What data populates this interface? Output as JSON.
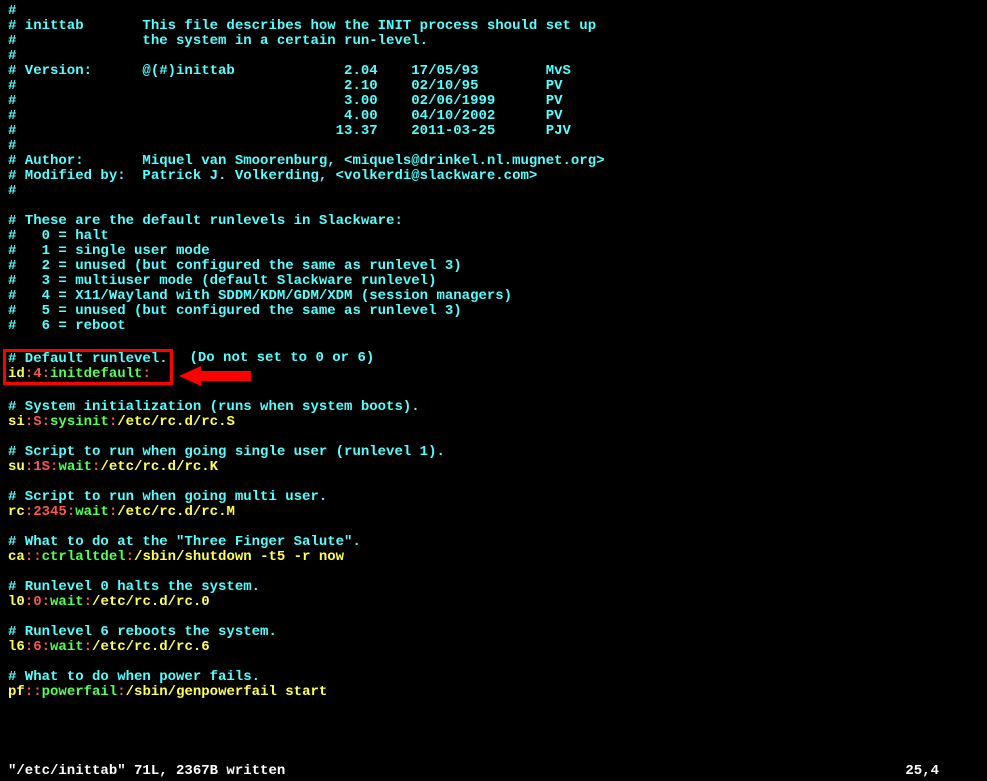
{
  "lines": [
    {
      "segments": [
        {
          "cls": "c",
          "t": "#"
        }
      ]
    },
    {
      "segments": [
        {
          "cls": "c",
          "t": "# inittab       This file describes how the INIT process should set up"
        }
      ]
    },
    {
      "segments": [
        {
          "cls": "c",
          "t": "#               the system in a certain run-level."
        }
      ]
    },
    {
      "segments": [
        {
          "cls": "c",
          "t": "#"
        }
      ]
    },
    {
      "segments": [
        {
          "cls": "c",
          "t": "# Version:      @(#)inittab             2.04    17/05/93        MvS"
        }
      ]
    },
    {
      "segments": [
        {
          "cls": "c",
          "t": "#                                       2.10    02/10/95        PV"
        }
      ]
    },
    {
      "segments": [
        {
          "cls": "c",
          "t": "#                                       3.00    02/06/1999      PV"
        }
      ]
    },
    {
      "segments": [
        {
          "cls": "c",
          "t": "#                                       4.00    04/10/2002      PV"
        }
      ]
    },
    {
      "segments": [
        {
          "cls": "c",
          "t": "#                                      13.37    2011-03-25      PJV"
        }
      ]
    },
    {
      "segments": [
        {
          "cls": "c",
          "t": "#"
        }
      ]
    },
    {
      "segments": [
        {
          "cls": "c",
          "t": "# Author:       Miquel van Smoorenburg, <miquels@drinkel.nl.mugnet.org>"
        }
      ]
    },
    {
      "segments": [
        {
          "cls": "c",
          "t": "# Modified by:  Patrick J. Volkerding, <volkerdi@slackware.com>"
        }
      ]
    },
    {
      "segments": [
        {
          "cls": "c",
          "t": "#"
        }
      ]
    },
    {
      "segments": [
        {
          "cls": "c",
          "t": ""
        }
      ]
    },
    {
      "segments": [
        {
          "cls": "c",
          "t": "# These are the default runlevels in Slackware:"
        }
      ]
    },
    {
      "segments": [
        {
          "cls": "c",
          "t": "#   0 = halt"
        }
      ]
    },
    {
      "segments": [
        {
          "cls": "c",
          "t": "#   1 = single user mode"
        }
      ]
    },
    {
      "segments": [
        {
          "cls": "c",
          "t": "#   2 = unused (but configured the same as runlevel 3)"
        }
      ]
    },
    {
      "segments": [
        {
          "cls": "c",
          "t": "#   3 = multiuser mode (default Slackware runlevel)"
        }
      ]
    },
    {
      "segments": [
        {
          "cls": "c",
          "t": "#   4 = X11/Wayland with SDDM/KDM/GDM/XDM (session managers)"
        }
      ]
    },
    {
      "segments": [
        {
          "cls": "c",
          "t": "#   5 = unused (but configured the same as runlevel 3)"
        }
      ]
    },
    {
      "segments": [
        {
          "cls": "c",
          "t": "#   6 = reboot"
        }
      ]
    },
    {
      "segments": [
        {
          "cls": "c",
          "t": ""
        }
      ]
    },
    {
      "highlight": true,
      "trailing": "  (Do not set to 0 or 6)",
      "segments": [
        {
          "cls": "c",
          "t": "# Default runlevel."
        }
      ],
      "line2": [
        {
          "cls": "y",
          "t": "id"
        },
        {
          "cls": "r",
          "t": ":"
        },
        {
          "cls": "r",
          "t": "4"
        },
        {
          "cls": "r",
          "t": ":"
        },
        {
          "cls": "g",
          "t": "initdefault"
        },
        {
          "cls": "r",
          "t": ":"
        }
      ]
    },
    {
      "segments": [
        {
          "cls": "c",
          "t": ""
        }
      ]
    },
    {
      "segments": [
        {
          "cls": "c",
          "t": "# System initialization (runs when system boots)."
        }
      ]
    },
    {
      "segments": [
        {
          "cls": "y",
          "t": "si"
        },
        {
          "cls": "r",
          "t": ":"
        },
        {
          "cls": "r",
          "t": "S"
        },
        {
          "cls": "r",
          "t": ":"
        },
        {
          "cls": "g",
          "t": "sysinit"
        },
        {
          "cls": "r",
          "t": ":"
        },
        {
          "cls": "y",
          "t": "/etc/rc.d/rc.S"
        }
      ]
    },
    {
      "segments": [
        {
          "cls": "c",
          "t": ""
        }
      ]
    },
    {
      "segments": [
        {
          "cls": "c",
          "t": "# Script to run when going single user (runlevel 1)."
        }
      ]
    },
    {
      "segments": [
        {
          "cls": "y",
          "t": "su"
        },
        {
          "cls": "r",
          "t": ":"
        },
        {
          "cls": "r",
          "t": "1S"
        },
        {
          "cls": "r",
          "t": ":"
        },
        {
          "cls": "g",
          "t": "wait"
        },
        {
          "cls": "r",
          "t": ":"
        },
        {
          "cls": "y",
          "t": "/etc/rc.d/rc.K"
        }
      ]
    },
    {
      "segments": [
        {
          "cls": "c",
          "t": ""
        }
      ]
    },
    {
      "segments": [
        {
          "cls": "c",
          "t": "# Script to run when going multi user."
        }
      ]
    },
    {
      "segments": [
        {
          "cls": "y",
          "t": "rc"
        },
        {
          "cls": "r",
          "t": ":"
        },
        {
          "cls": "r",
          "t": "2345"
        },
        {
          "cls": "r",
          "t": ":"
        },
        {
          "cls": "g",
          "t": "wait"
        },
        {
          "cls": "r",
          "t": ":"
        },
        {
          "cls": "y",
          "t": "/etc/rc.d/rc.M"
        }
      ]
    },
    {
      "segments": [
        {
          "cls": "c",
          "t": ""
        }
      ]
    },
    {
      "segments": [
        {
          "cls": "c",
          "t": "# What to do at the \"Three Finger Salute\"."
        }
      ]
    },
    {
      "segments": [
        {
          "cls": "y",
          "t": "ca"
        },
        {
          "cls": "r",
          "t": "::"
        },
        {
          "cls": "g",
          "t": "ctrlaltdel"
        },
        {
          "cls": "r",
          "t": ":"
        },
        {
          "cls": "y",
          "t": "/sbin/shutdown -t5 -r now"
        }
      ]
    },
    {
      "segments": [
        {
          "cls": "c",
          "t": ""
        }
      ]
    },
    {
      "segments": [
        {
          "cls": "c",
          "t": "# Runlevel 0 halts the system."
        }
      ]
    },
    {
      "segments": [
        {
          "cls": "y",
          "t": "l0"
        },
        {
          "cls": "r",
          "t": ":"
        },
        {
          "cls": "r",
          "t": "0"
        },
        {
          "cls": "r",
          "t": ":"
        },
        {
          "cls": "g",
          "t": "wait"
        },
        {
          "cls": "r",
          "t": ":"
        },
        {
          "cls": "y",
          "t": "/etc/rc.d/rc.0"
        }
      ]
    },
    {
      "segments": [
        {
          "cls": "c",
          "t": ""
        }
      ]
    },
    {
      "segments": [
        {
          "cls": "c",
          "t": "# Runlevel 6 reboots the system."
        }
      ]
    },
    {
      "segments": [
        {
          "cls": "y",
          "t": "l6"
        },
        {
          "cls": "r",
          "t": ":"
        },
        {
          "cls": "r",
          "t": "6"
        },
        {
          "cls": "r",
          "t": ":"
        },
        {
          "cls": "g",
          "t": "wait"
        },
        {
          "cls": "r",
          "t": ":"
        },
        {
          "cls": "y",
          "t": "/etc/rc.d/rc.6"
        }
      ]
    },
    {
      "segments": [
        {
          "cls": "c",
          "t": ""
        }
      ]
    },
    {
      "segments": [
        {
          "cls": "c",
          "t": "# What to do when power fails."
        }
      ]
    },
    {
      "segments": [
        {
          "cls": "y",
          "t": "pf"
        },
        {
          "cls": "r",
          "t": "::"
        },
        {
          "cls": "g",
          "t": "powerfail"
        },
        {
          "cls": "r",
          "t": ":"
        },
        {
          "cls": "y",
          "t": "/sbin/genpowerfail start"
        }
      ]
    }
  ],
  "status": {
    "left": "\"/etc/inittab\" 71L, 2367B written",
    "right": "25,4"
  }
}
